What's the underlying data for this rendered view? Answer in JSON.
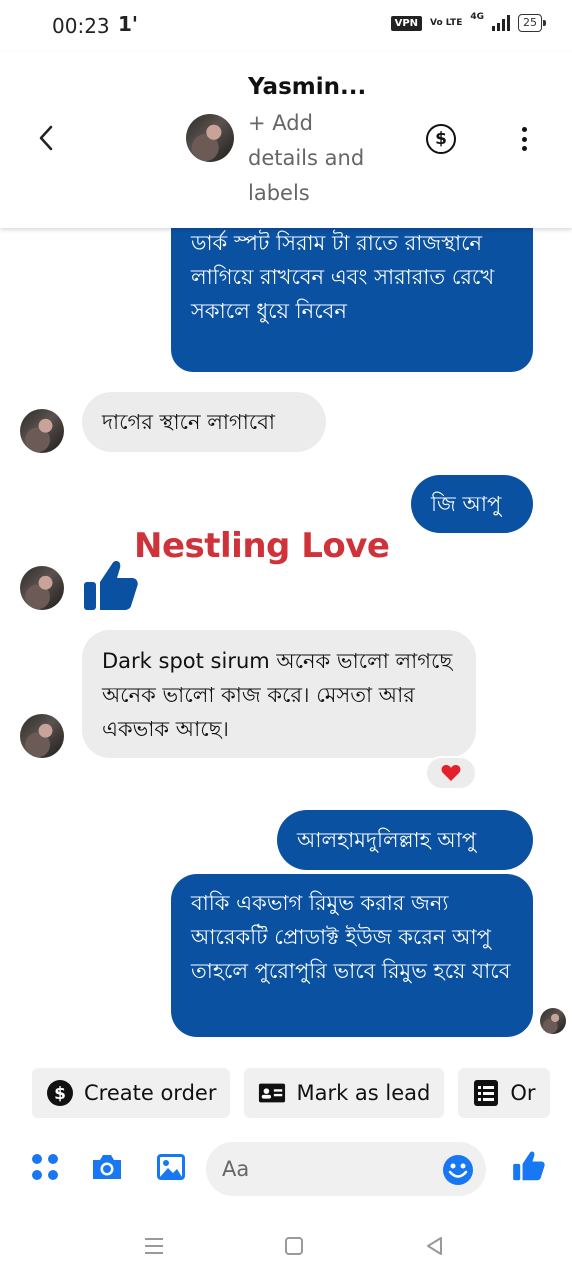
{
  "status_bar": {
    "time": "00:23",
    "extra": "1'",
    "vpn": "VPN",
    "volte": "Vo LTE",
    "network": "4G",
    "battery": "25"
  },
  "header": {
    "name": "Yasmin...",
    "subtitle": "+ Add details and labels",
    "back_icon": "chevron-left-icon",
    "dollar_icon": "dollar-icon",
    "more_icon": "more-vertical-icon"
  },
  "messages": [
    {
      "direction": "outgoing",
      "text": "ডার্ক স্পট সিরাম টা রাতে রাজস্থানে লাগিয়ে রাখবেন এবং সারারাত রেখে সকালে ধুয়ে নিবেন"
    },
    {
      "direction": "incoming",
      "text": "দাগের স্থানে লাগাবো"
    },
    {
      "direction": "outgoing",
      "text": "জি আপু"
    },
    {
      "direction": "incoming",
      "type": "like",
      "icon": "thumbs-up-icon"
    },
    {
      "direction": "incoming",
      "text": "Dark spot sirum অনেক ভালো লাগছে অনেক ভালো কাজ করে। মেসতা আর একভাক আছে।",
      "reaction": "❤️"
    },
    {
      "direction": "outgoing",
      "text": "আলহামদুলিল্লাহ আপু"
    },
    {
      "direction": "outgoing",
      "text": "বাকি একভাগ রিমুভ করার জন্য আরেকটি প্রোডাক্ট ইউজ করেন আপু তাহলে পুরোপুরি ভাবে রিমুভ হয়ে যাবে"
    }
  ],
  "overlay_text": "Nestling Love",
  "quick_actions": [
    {
      "label": "Create order",
      "icon": "dollar-circle-icon"
    },
    {
      "label": "Mark as lead",
      "icon": "id-card-icon"
    },
    {
      "label": "Or",
      "icon": "order-list-icon"
    }
  ],
  "composer": {
    "placeholder": "Aa",
    "icons": [
      "apps-icon",
      "camera-icon",
      "gallery-icon",
      "emoji-icon",
      "thumbs-up-icon"
    ]
  },
  "colors": {
    "outgoing_bubble": "#0a52a1",
    "incoming_bubble": "#ececec",
    "accent": "#1877f2",
    "overlay_text": "#d0323a"
  }
}
